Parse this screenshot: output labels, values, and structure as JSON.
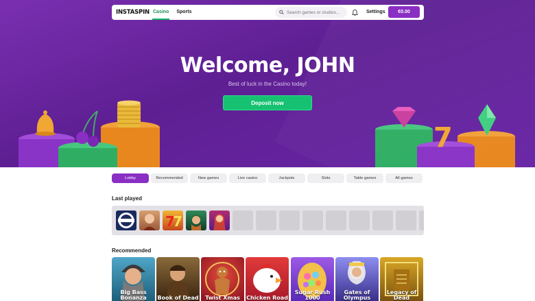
{
  "nav": {
    "logo": "INSTASPIN",
    "tabs": [
      {
        "label": "Casino",
        "active": true
      },
      {
        "label": "Sports",
        "active": false
      }
    ],
    "search_placeholder": "Search games or studios...",
    "settings_label": "Settings",
    "balance": "€0.00"
  },
  "hero": {
    "title": "Welcome, JOHN",
    "subtitle": "Best of luck in the Casino today!",
    "cta": "Deposit now"
  },
  "categories": [
    "Lobby",
    "Recommended",
    "New games",
    "Live casino",
    "Jackpots",
    "Slots",
    "Table games",
    "All games"
  ],
  "last_played": {
    "title": "Last played",
    "games": [
      "game-1",
      "game-2",
      "game-3",
      "game-4",
      "game-5"
    ]
  },
  "recommended": {
    "title": "Recommended",
    "games": [
      {
        "title": "Big Bass Bonanza",
        "color": "#1e6f8a"
      },
      {
        "title": "Book of Dead",
        "color": "#5a3b1f"
      },
      {
        "title": "Twist Xmas",
        "color": "#b0252a"
      },
      {
        "title": "Chicken Road",
        "color": "#d32b2b"
      },
      {
        "title": "Sugar Rush 1000",
        "color": "#6f40c8"
      },
      {
        "title": "Gates of Olympus",
        "color": "#4d4fb3"
      },
      {
        "title": "Legacy of Dead",
        "color": "#b88a16"
      }
    ]
  },
  "colors": {
    "brand": "#8a2fc3",
    "accent": "#16c172",
    "hero": "#6a27a6"
  }
}
